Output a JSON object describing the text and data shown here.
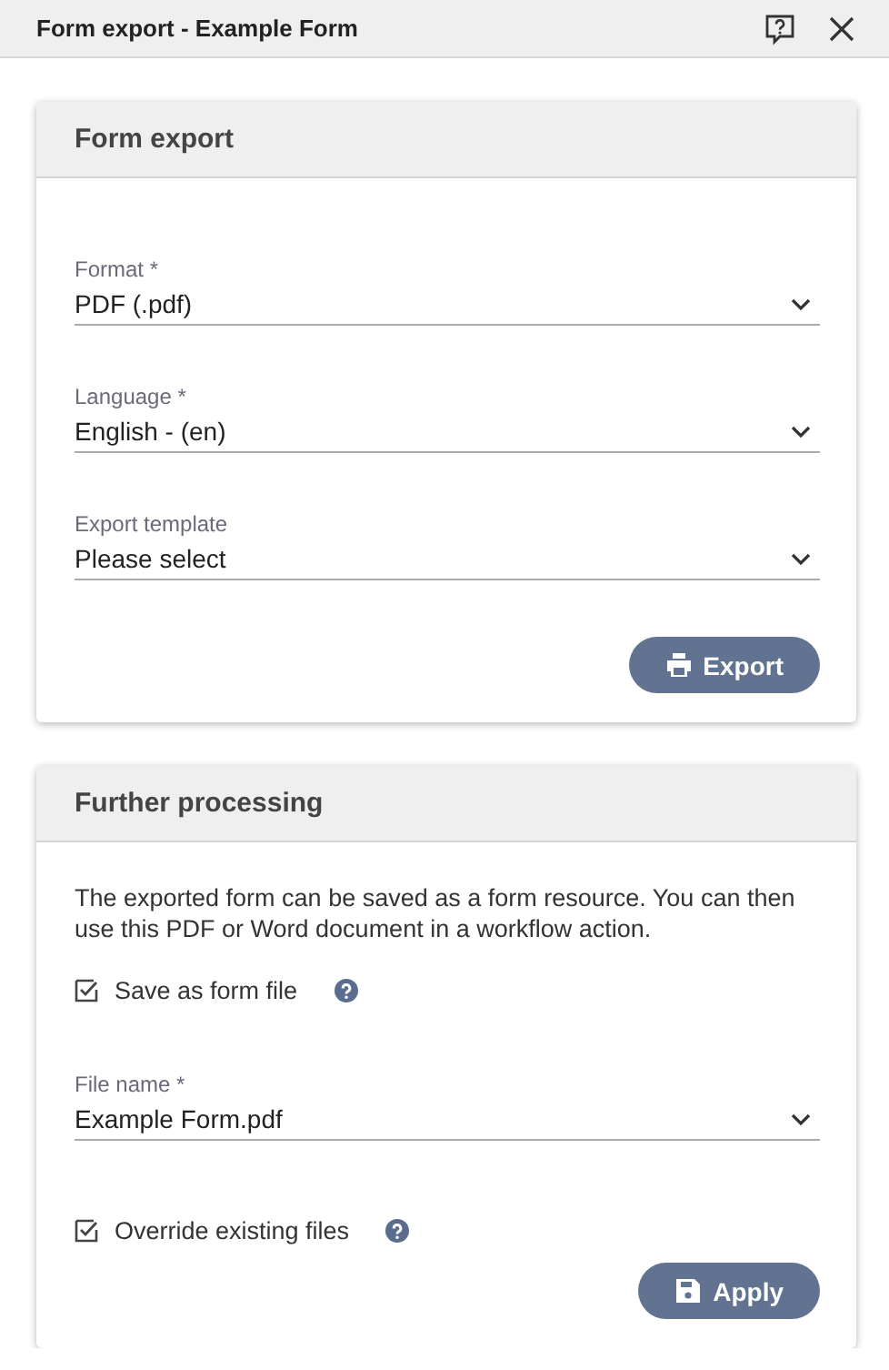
{
  "window": {
    "title": "Form export - Example Form"
  },
  "cards": [
    {
      "title": "Form export",
      "items": [
        {
          "kind": "select",
          "label": "Format *",
          "value": "PDF (.pdf)"
        },
        {
          "kind": "select",
          "label": "Language *",
          "value": "English - (en)"
        },
        {
          "kind": "select",
          "label": "Export template",
          "value": "Please select"
        },
        {
          "kind": "button",
          "label": "Export"
        }
      ]
    },
    {
      "title": "Further processing",
      "items": [
        {
          "kind": "text",
          "text": "The exported form can be saved as a form resource. You can then use this PDF or Word document in a workflow action."
        },
        {
          "kind": "checkbox",
          "label": "Save as form file",
          "checked": true,
          "help": true
        },
        {
          "kind": "select",
          "label": "File name *",
          "value": "Example Form.pdf"
        },
        {
          "kind": "checkbox",
          "label": "Override existing files",
          "checked": true,
          "help": true
        },
        {
          "kind": "button",
          "label": "Apply"
        }
      ]
    }
  ]
}
